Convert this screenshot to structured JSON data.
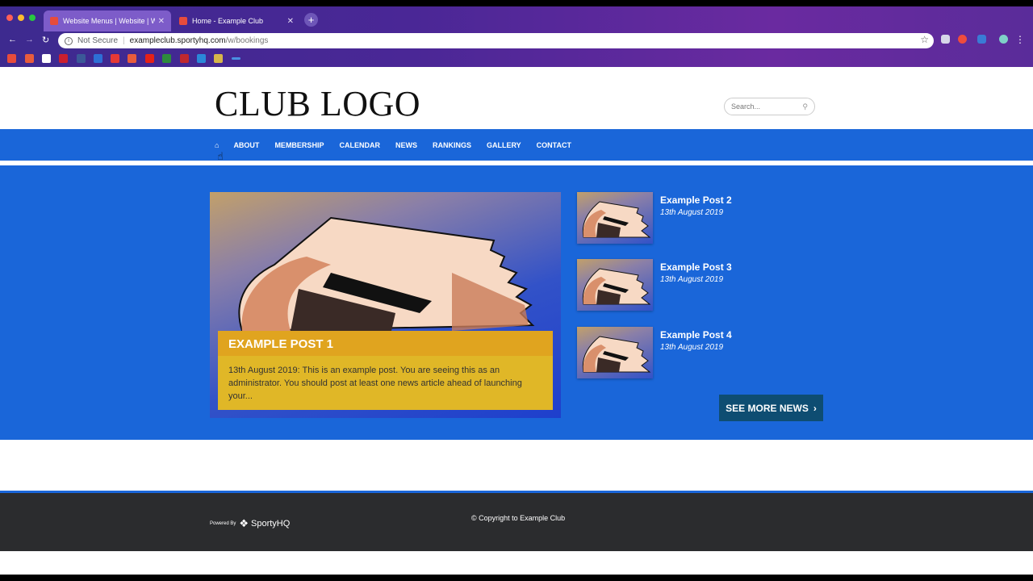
{
  "browser": {
    "tabs": [
      {
        "title": "Website Menus | Website | We",
        "active": true
      },
      {
        "title": "Home - Example Club",
        "active": false
      }
    ],
    "address": {
      "security": "Not Secure",
      "host": "exampleclub.sportyhq.com",
      "path": "/w/bookings"
    }
  },
  "header": {
    "logo": "CLUB LOGO",
    "search_placeholder": "Search..."
  },
  "nav": {
    "items": [
      "ABOUT",
      "MEMBERSHIP",
      "CALENDAR",
      "NEWS",
      "RANKINGS",
      "GALLERY",
      "CONTACT"
    ]
  },
  "news": {
    "featured": {
      "title": "EXAMPLE POST 1",
      "excerpt": "13th August 2019: This is an example post. You are seeing this as an administrator. You should post at least one news article ahead of launching your..."
    },
    "posts": [
      {
        "title": "Example Post 2",
        "date": "13th August 2019"
      },
      {
        "title": "Example Post 3",
        "date": "13th August 2019"
      },
      {
        "title": "Example Post 4",
        "date": "13th August 2019"
      }
    ],
    "more_label": "SEE MORE NEWS"
  },
  "footer": {
    "powered_by": "Powered By",
    "brand": "SportyHQ",
    "copyright": "© Copyright to Example Club"
  },
  "colors": {
    "primary_blue": "#1a66d9",
    "accent_yellow": "#e0b727",
    "button_dark": "#0e4d72",
    "footer_bg": "#2b2c2e"
  }
}
